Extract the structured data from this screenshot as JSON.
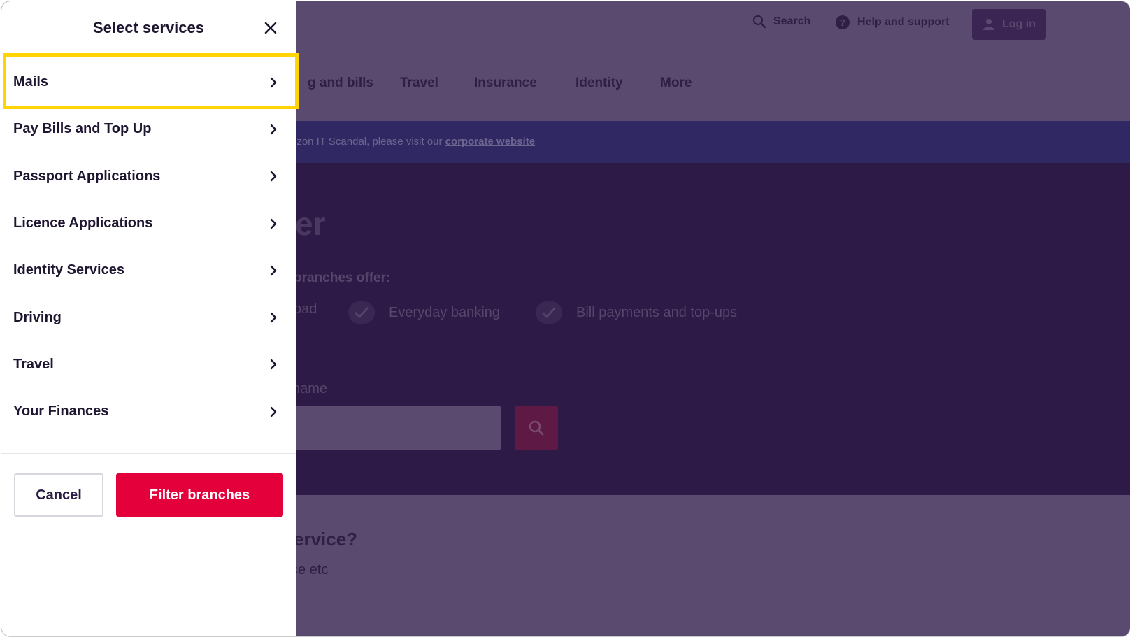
{
  "drawer": {
    "title": "Select services",
    "items": [
      {
        "label": "Mails"
      },
      {
        "label": "Pay Bills and Top Up"
      },
      {
        "label": "Passport Applications"
      },
      {
        "label": "Licence Applications"
      },
      {
        "label": "Identity Services"
      },
      {
        "label": "Driving"
      },
      {
        "label": "Travel"
      },
      {
        "label": "Your Finances"
      }
    ],
    "cancel_label": "Cancel",
    "filter_label": "Filter branches",
    "highlight_color": "#ffd400",
    "primary_color": "#e4003b"
  },
  "header": {
    "search_label": "Search",
    "help_label": "Help and support",
    "login_label": "Log in"
  },
  "nav": {
    "items": [
      "g and bills",
      "Travel",
      "Insurance",
      "Identity",
      "More"
    ]
  },
  "banner": {
    "text": "rizon IT Scandal, please visit our ",
    "link": "corporate website"
  },
  "hero": {
    "title": "er",
    "subtitle": "pranches offer:",
    "features": [
      "oad",
      "Everyday banking",
      "Bill payments and top-ups"
    ],
    "search_label": "name"
  },
  "lower": {
    "question": "ervice?",
    "sub": "ce etc"
  }
}
